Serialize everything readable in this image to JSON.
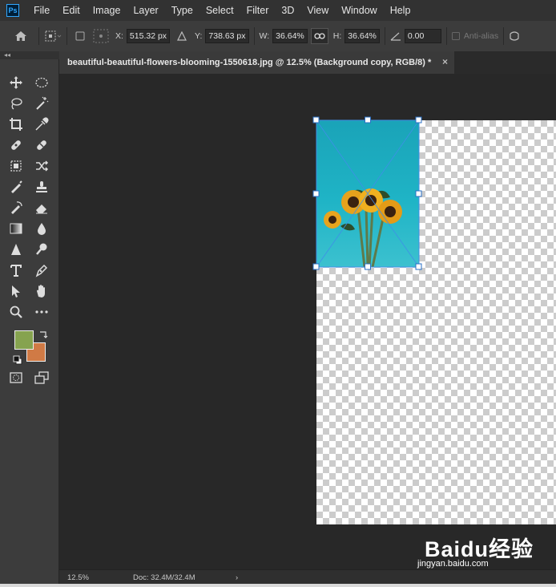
{
  "app": {
    "logo_text": "Ps"
  },
  "menu": [
    "File",
    "Edit",
    "Image",
    "Layer",
    "Type",
    "Select",
    "Filter",
    "3D",
    "View",
    "Window",
    "Help"
  ],
  "options": {
    "x_label": "X:",
    "x_value": "515.32 px",
    "y_label": "Y:",
    "y_value": "738.63 px",
    "w_label": "W:",
    "w_value": "36.64%",
    "h_label": "H:",
    "h_value": "36.64%",
    "angle_value": "0.00",
    "antialias_label": "Anti-alias"
  },
  "toolbar": {
    "collapse_glyph": "◂◂"
  },
  "document_tab": {
    "title": "beautiful-beautiful-flowers-blooming-1550618.jpg @ 12.5% (Background copy, RGB/8) *",
    "close_glyph": "×"
  },
  "colors": {
    "foreground": "#86a34f",
    "background": "#d07a45",
    "canvas_bg": "#282828",
    "photo_bg": "#1fb4c6"
  },
  "status": {
    "zoom": "12.5%",
    "doc_info": "Doc: 32.4M/32.4M",
    "arrow": "›"
  },
  "watermark": {
    "brand": "Baidu经验",
    "url": "jingyan.baidu.com"
  }
}
